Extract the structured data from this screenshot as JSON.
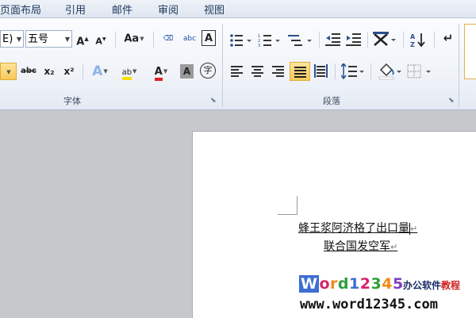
{
  "tabs": [
    "页面布局",
    "引用",
    "邮件",
    "审阅",
    "视图"
  ],
  "font": {
    "name_partial": "E)",
    "size": "五号",
    "group_label": "字体",
    "buttons": {
      "grow": "A",
      "shrink": "A",
      "change_case": "Aa",
      "phonetic": "abc",
      "char_border": "A",
      "strike": "abc",
      "subscript": "x₂",
      "superscript": "x²",
      "text_effect": "A",
      "highlight": "ab",
      "font_color": "A",
      "char_shading": "A",
      "enclose": "字"
    }
  },
  "paragraph": {
    "group_label": "段落"
  },
  "document": {
    "line1": "蜂王浆阿济格了出口量",
    "line2": "联合国发空军"
  },
  "watermark": {
    "logo_letters": [
      "W",
      "o",
      "r",
      "d",
      "1",
      "2",
      "3",
      "4",
      "5"
    ],
    "tag_a": "办公软件",
    "tag_b": "教程",
    "url": "www.word12345.com"
  },
  "colors": {
    "highlight_yellow": "#f5e100",
    "font_red": "#e02020",
    "ribbon_bg": "#eef2f8"
  }
}
